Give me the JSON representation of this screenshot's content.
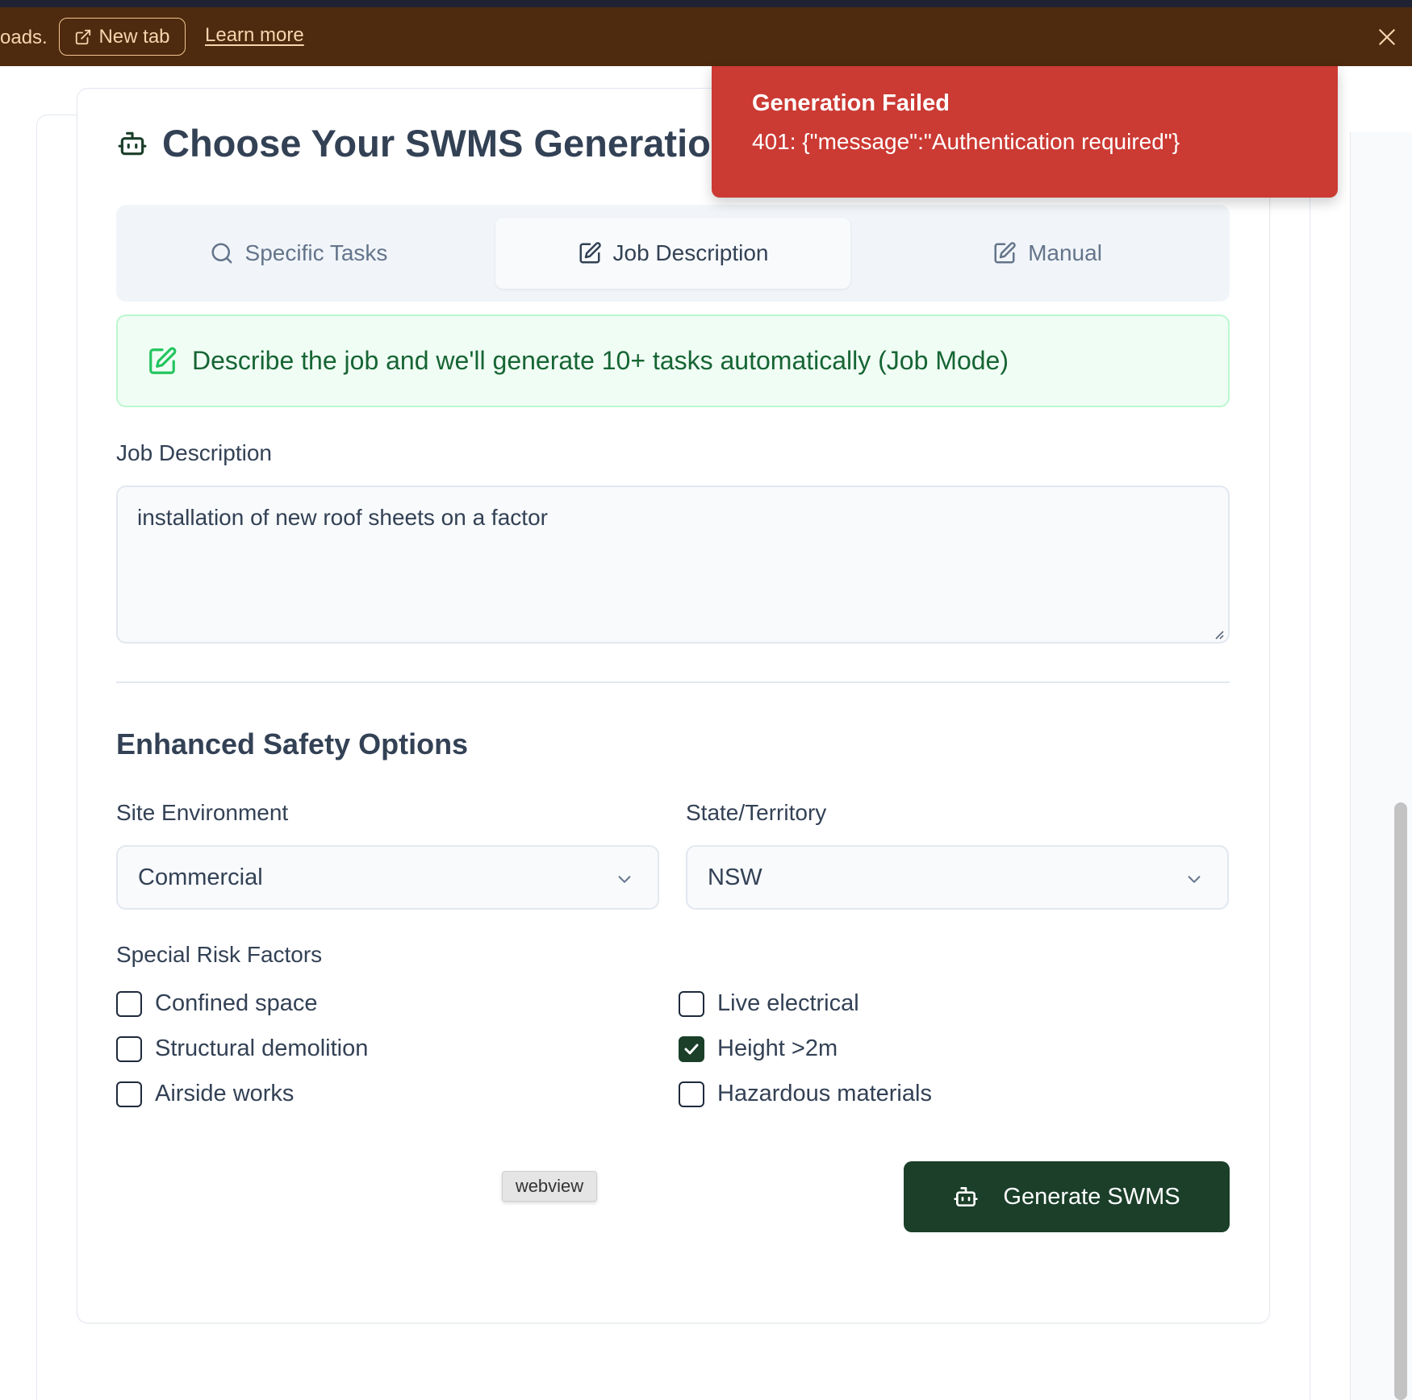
{
  "browser_banner": {
    "partial_text": "oads.",
    "new_tab_label": "New tab",
    "learn_more_label": "Learn more"
  },
  "card": {
    "title": "Choose Your SWMS Generation"
  },
  "tabs": [
    {
      "label": "Specific Tasks",
      "icon": "search-icon",
      "active": false
    },
    {
      "label": "Job Description",
      "icon": "edit-icon",
      "active": true
    },
    {
      "label": "Manual",
      "icon": "edit-icon",
      "active": false
    }
  ],
  "info": {
    "text": "Describe the job and we'll generate 10+ tasks automatically (Job Mode)"
  },
  "job_description": {
    "label": "Job Description",
    "value": "installation of new roof sheets on a factor"
  },
  "safety": {
    "title": "Enhanced Safety Options",
    "site_environment": {
      "label": "Site Environment",
      "value": "Commercial"
    },
    "state": {
      "label": "State/Territory",
      "value": "NSW"
    },
    "risk_factors_label": "Special Risk Factors",
    "risk_factors": [
      {
        "label": "Confined space",
        "checked": false
      },
      {
        "label": "Live electrical",
        "checked": false
      },
      {
        "label": "Structural demolition",
        "checked": false
      },
      {
        "label": "Height >2m",
        "checked": true
      },
      {
        "label": "Airside works",
        "checked": false
      },
      {
        "label": "Hazardous materials",
        "checked": false
      }
    ]
  },
  "webview_tag": "webview",
  "generate_button": "Generate SWMS",
  "toast": {
    "title": "Generation Failed",
    "message": "401: {\"message\":\"Authentication required\"}"
  },
  "colors": {
    "banner_bg": "#4e2a0e",
    "accent_green": "#1b3f29",
    "toast_red": "#cb3a33",
    "info_green_bg": "#f0fdf4",
    "info_green_text": "#166534"
  }
}
